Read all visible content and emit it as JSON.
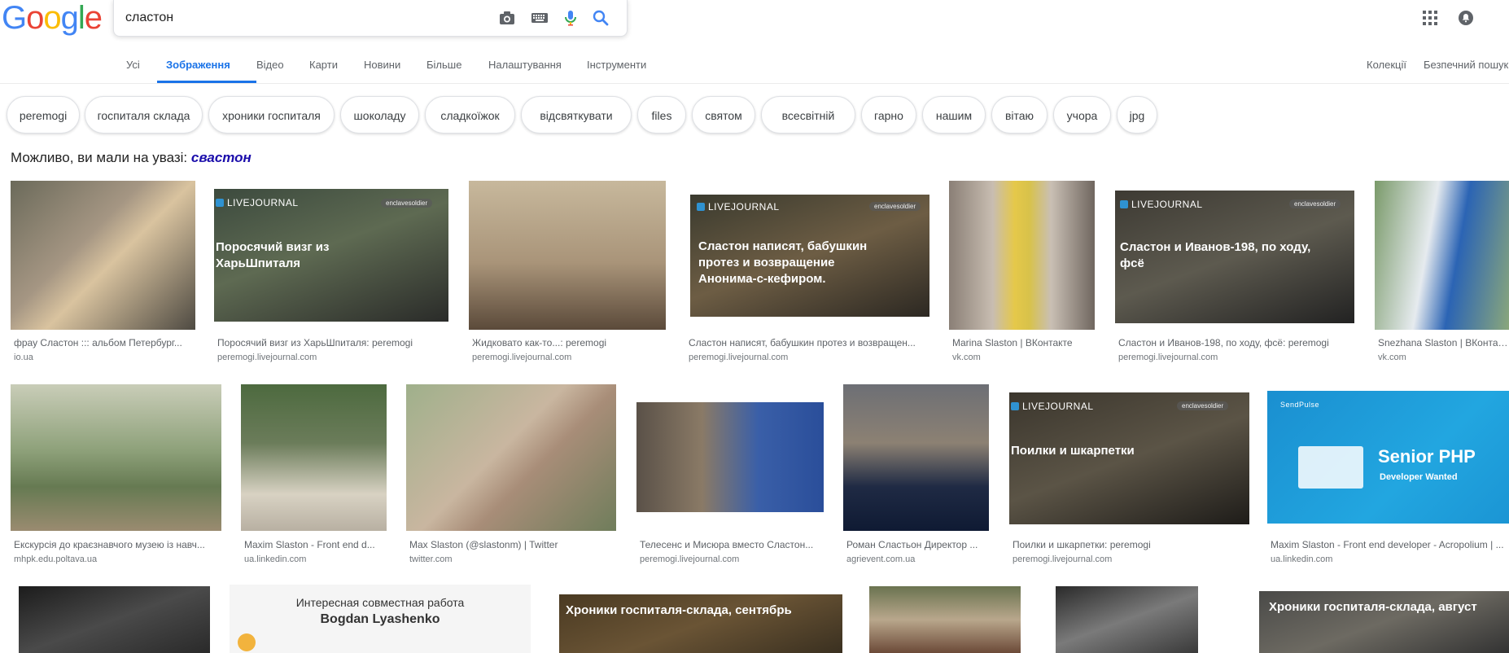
{
  "logo": {
    "letters": [
      "G",
      "o",
      "o",
      "g",
      "l",
      "e"
    ],
    "colors": [
      "#4285f4",
      "#ea4335",
      "#fbbc05",
      "#4285f4",
      "#34a853",
      "#ea4335"
    ]
  },
  "search": {
    "value": "сластон",
    "icons": [
      "camera-icon",
      "keyboard-icon",
      "microphone-icon",
      "search-icon"
    ]
  },
  "header_icons": [
    "apps-icon",
    "notifications-icon"
  ],
  "tabs": [
    {
      "label": "Усі"
    },
    {
      "label": "Зображення"
    },
    {
      "label": "Відео"
    },
    {
      "label": "Карти"
    },
    {
      "label": "Новини"
    },
    {
      "label": "Більше"
    },
    {
      "label": "Налаштування"
    },
    {
      "label": "Інструменти"
    }
  ],
  "right_tabs": [
    {
      "label": "Колекції"
    },
    {
      "label": "Безпечний пошук"
    }
  ],
  "chips": [
    "peremogi",
    "госпиталя склада",
    "хроники госпиталя",
    "шоколаду",
    "сладкоїжок",
    "відсвяткувати",
    "files",
    "святом",
    "всесвітній",
    "гарно",
    "нашим",
    "вітаю",
    "учора",
    "jpg"
  ],
  "did_you_mean": {
    "prefix": "Можливо, ви мали на увазі:",
    "suggestion": "свастон"
  },
  "results": [
    {
      "caption": "фрау Сластон ::: альбом Петербург...",
      "domain": "io.ua"
    },
    {
      "caption": "Поросячий визг из ХарьШпиталя: peremogi",
      "domain": "peremogi.livejournal.com",
      "overlay": "Поросячий визг из ХарьШпиталя",
      "brand": "LIVEJOURNAL",
      "tag": "enclavesoldier"
    },
    {
      "caption": "Жидковато как-то...: peremogi",
      "domain": "peremogi.livejournal.com"
    },
    {
      "caption": "Сластон написят, бабушкин протез и возвращен...",
      "domain": "peremogi.livejournal.com",
      "overlay": "Сластон написят, бабушкин протез и возвращение Анонима-с-кефиром.",
      "brand": "LIVEJOURNAL",
      "tag": "enclavesoldier"
    },
    {
      "caption": "Marina Slaston | ВКонтакте",
      "domain": "vk.com"
    },
    {
      "caption": "Сластон и Иванов-198, по ходу, фсё: peremogi",
      "domain": "peremogi.livejournal.com",
      "overlay": "Сластон и Иванов-198, по ходу, фсё",
      "brand": "LIVEJOURNAL",
      "tag": "enclavesoldier"
    },
    {
      "caption": "Snezhana Slaston | ВКонтакте",
      "domain": "vk.com"
    },
    {
      "caption": "Екскурсія до краєзнавчого музею із навч...",
      "domain": "mhpk.edu.poltava.ua"
    },
    {
      "caption": "Maxim Slaston - Front end d...",
      "domain": "ua.linkedin.com"
    },
    {
      "caption": "Max Slaston (@slastonm) | Twitter",
      "domain": "twitter.com"
    },
    {
      "caption": "Телесенс и Мисюра вместо Сластон...",
      "domain": "peremogi.livejournal.com"
    },
    {
      "caption": "Роман Сластьон Директор ...",
      "domain": "agrievent.com.ua"
    },
    {
      "caption": "Поилки и шкарпетки: peremogi",
      "domain": "peremogi.livejournal.com",
      "overlay": "Поилки и шкарпетки",
      "brand": "LIVEJOURNAL",
      "tag": "enclavesoldier"
    },
    {
      "caption": "Maxim Slaston - Front end developer - Acropolium | ...",
      "domain": "ua.linkedin.com",
      "overlay": "Senior PHP",
      "overlay2": "Developer Wanted",
      "brand": "SendPulse"
    },
    {
      "caption": "",
      "domain": ""
    },
    {
      "caption": "",
      "domain": "",
      "overlay": "Интересная совместная работа",
      "overlay2": "Bogdan Lyashenko"
    },
    {
      "caption": "",
      "domain": "",
      "overlay": "Хроники госпиталя-склада, сентябрь"
    },
    {
      "caption": "",
      "domain": ""
    },
    {
      "caption": "",
      "domain": ""
    },
    {
      "caption": "",
      "domain": "",
      "overlay": "Хроники госпиталя-склада, август"
    }
  ],
  "colors": {
    "accent": "#1a73e8",
    "link": "#1a0dab"
  }
}
